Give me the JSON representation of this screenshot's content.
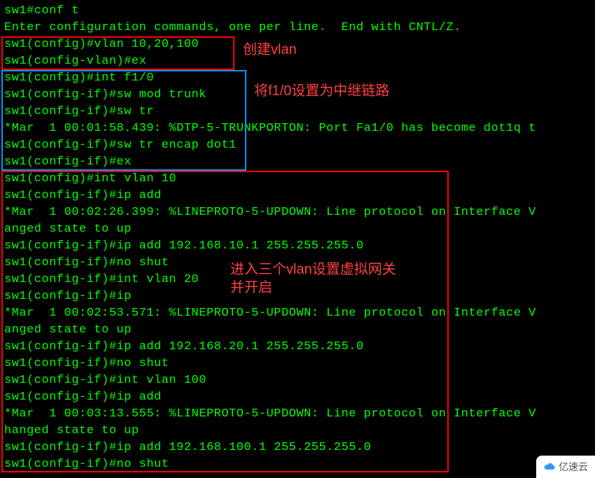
{
  "terminal": {
    "lines": [
      "sw1#conf t",
      "Enter configuration commands, one per line.  End with CNTL/Z.",
      "sw1(config)#vlan 10,20,100",
      "sw1(config-vlan)#ex",
      "sw1(config)#int f1/0",
      "sw1(config-if)#sw mod trunk",
      "sw1(config-if)#sw tr",
      "*Mar  1 00:01:58.439: %DTP-5-TRUNKPORTON: Port Fa1/0 has become dot1q t",
      "sw1(config-if)#sw tr encap dot1",
      "sw1(config-if)#ex",
      "sw1(config)#int vlan 10",
      "sw1(config-if)#ip add",
      "*Mar  1 00:02:26.399: %LINEPROTO-5-UPDOWN: Line protocol on Interface V",
      "anged state to up",
      "sw1(config-if)#ip add 192.168.10.1 255.255.255.0",
      "sw1(config-if)#no shut",
      "sw1(config-if)#int vlan 20",
      "sw1(config-if)#ip",
      "*Mar  1 00:02:53.571: %LINEPROTO-5-UPDOWN: Line protocol on Interface V",
      "anged state to up",
      "sw1(config-if)#ip add 192.168.20.1 255.255.255.0",
      "sw1(config-if)#no shut",
      "sw1(config-if)#int vlan 100",
      "sw1(config-if)#ip add",
      "*Mar  1 00:03:13.555: %LINEPROTO-5-UPDOWN: Line protocol on Interface V",
      "hanged state to up",
      "sw1(config-if)#ip add 192.168.100.1 255.255.255.0",
      "sw1(config-if)#no shut"
    ]
  },
  "annotations": {
    "box1_label": "创建vlan",
    "box2_label": "将f1/0设置为中继链路",
    "box3_label1": "进入三个vlan设置虚拟网关",
    "box3_label2": "并开启"
  },
  "watermark": {
    "text": "亿速云"
  }
}
